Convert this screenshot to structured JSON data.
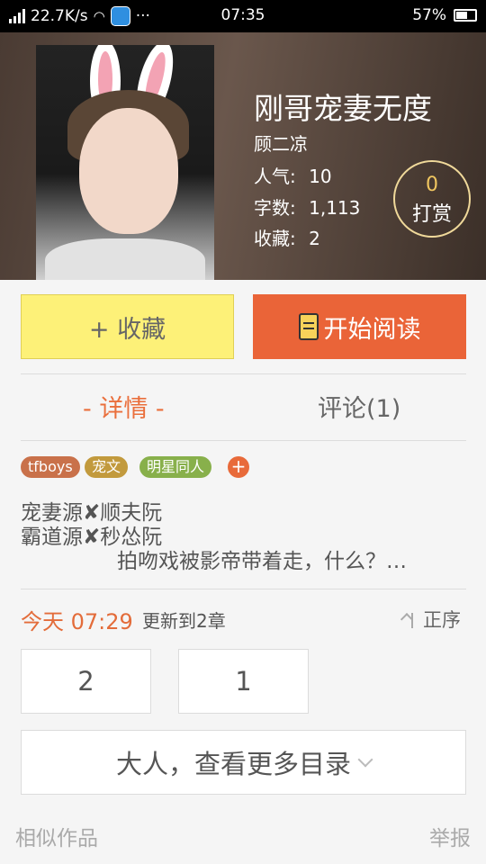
{
  "status_bar": {
    "speed": "22.7K/s",
    "dots": "···",
    "time": "07:35",
    "battery": "57%"
  },
  "book": {
    "title": "刚哥宠妻无度",
    "author": "顾二凉",
    "popularity_label": "人气:",
    "popularity": "10",
    "words_label": "字数:",
    "words": "1,113",
    "favorites_label": "收藏:",
    "favorites": "2"
  },
  "reward": {
    "count": "0",
    "label": "打赏"
  },
  "actions": {
    "favorite": "+ 收藏",
    "read": "开始阅读"
  },
  "tabs": {
    "detail": "- 详情 -",
    "comments": "评论(1)"
  },
  "tags": [
    {
      "label": "tfboys",
      "color": "#c9714a"
    },
    {
      "label": "宠文",
      "color": "#c29a3d"
    },
    {
      "label": "明星同人",
      "color": "#88b04b"
    }
  ],
  "tag_add": "+",
  "description": {
    "line1": "宠妻源✘顺夫阮",
    "line2": "霸道源✘秒怂阮",
    "line3": "拍吻戏被影帝带着走，什么？…"
  },
  "update": {
    "today": "今天 07:29",
    "text": "更新到2章",
    "sort": "正序"
  },
  "chapters": [
    "2",
    "1"
  ],
  "more_catalog": "大人，查看更多目录",
  "footer": {
    "similar": "相似作品",
    "report": "举报"
  }
}
